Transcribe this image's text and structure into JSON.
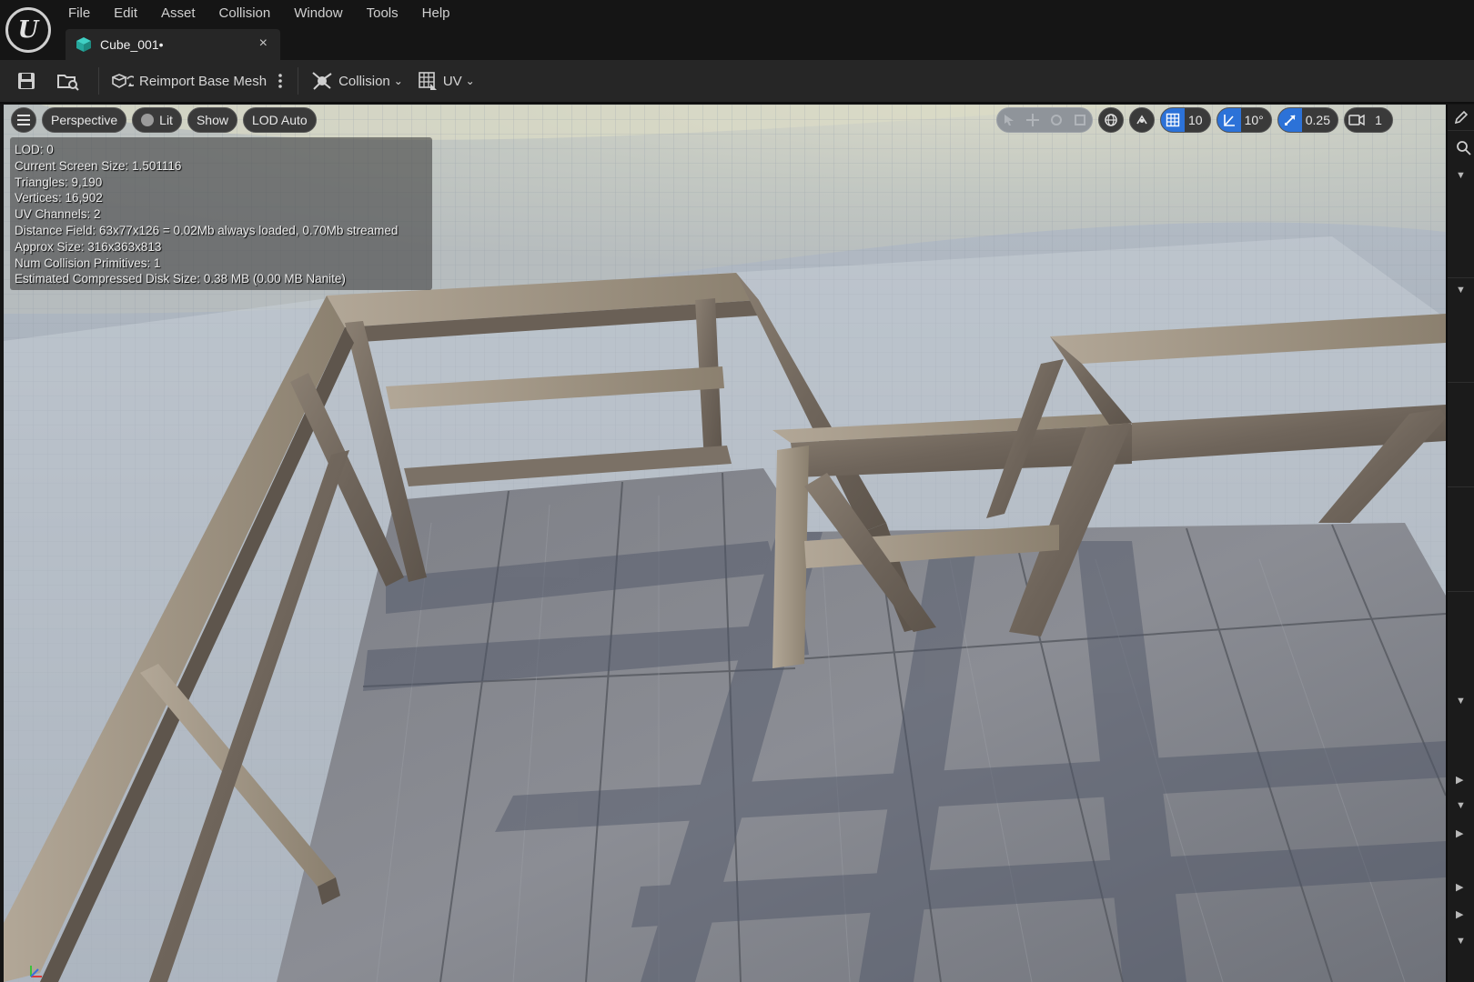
{
  "menubar": {
    "items": [
      "File",
      "Edit",
      "Asset",
      "Collision",
      "Window",
      "Tools",
      "Help"
    ]
  },
  "asset_tab": {
    "label": "Cube_001•",
    "close": "×"
  },
  "toolbar": {
    "reimport_label": "Reimport Base Mesh",
    "collision_label": "Collision",
    "uv_label": "UV"
  },
  "viewport": {
    "view_mode": "Perspective",
    "lighting_mode": "Lit",
    "show_label": "Show",
    "lod_label": "LOD Auto",
    "grid_snap_value": "10",
    "rotation_snap_value": "10°",
    "scale_snap_value": "0.25",
    "camera_speed_value": "1"
  },
  "stats": {
    "lines": [
      "LOD:  0",
      "Current Screen Size:  1.501116",
      "Triangles:  9,190",
      "Vertices:  16,902",
      "UV Channels:  2",
      "Distance Field:  63x77x126 = 0.02Mb always loaded, 0.70Mb streamed",
      "Approx Size: 316x363x813",
      "Num Collision Primitives:  1",
      "Estimated Compressed Disk Size: 0.38 MB (0.00 MB Nanite)"
    ]
  },
  "colors": {
    "accent_blue": "#2c72d8",
    "teal_icon": "#2fb9b0",
    "menubar_bg": "#151515",
    "toolbar_bg": "#262626"
  }
}
